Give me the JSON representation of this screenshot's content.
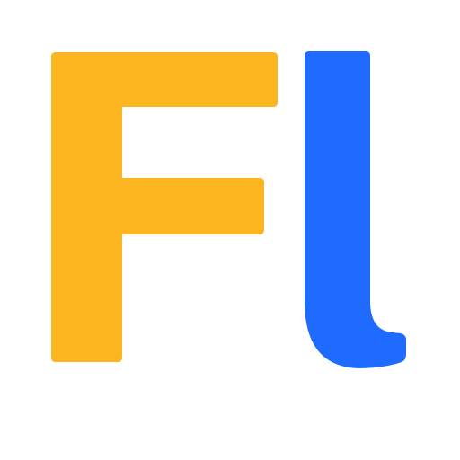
{
  "logo": {
    "text": "Fl",
    "colors": {
      "background": "#FFFFFF",
      "letter_f": "#FDB51F",
      "letter_l": "#1F6BFF"
    }
  }
}
